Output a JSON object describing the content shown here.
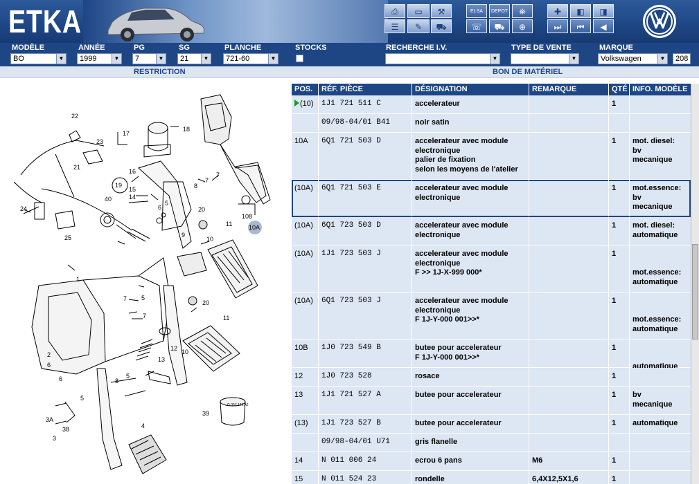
{
  "app": {
    "logo": "ETKA"
  },
  "toolbar": {
    "buttons": [
      {
        "name": "print-icon",
        "glyph": "⎙"
      },
      {
        "name": "monitor-icon",
        "glyph": "▭"
      },
      {
        "name": "tools-icon",
        "glyph": "⚒"
      },
      {
        "name": "list-icon",
        "glyph": "☰"
      },
      {
        "name": "pencil-icon",
        "glyph": "✎"
      },
      {
        "name": "cart-icon",
        "glyph": "⛟"
      },
      {
        "name": "elsa-icon",
        "label": "ELSA"
      },
      {
        "name": "depot-icon",
        "label": "DEPOT"
      },
      {
        "name": "basket-icon",
        "glyph": "🛒"
      },
      {
        "name": "pin-icon",
        "glyph": "✚"
      },
      {
        "name": "doc-prev-icon",
        "glyph": "◧"
      },
      {
        "name": "doc-next-icon",
        "glyph": "◨"
      },
      {
        "name": "last-icon",
        "glyph": "⏭"
      },
      {
        "name": "first-icon",
        "glyph": "⏮"
      },
      {
        "name": "back-icon",
        "glyph": "◀"
      }
    ]
  },
  "filters": {
    "modele": {
      "label": "MODÈLE",
      "value": "BO"
    },
    "annee": {
      "label": "ANNÉE",
      "value": "1999"
    },
    "pg": {
      "label": "PG",
      "value": "7"
    },
    "sg": {
      "label": "SG",
      "value": "21"
    },
    "planche": {
      "label": "PLANCHE",
      "value": "721-60"
    },
    "stocks": {
      "label": "STOCKS"
    },
    "recherche": {
      "label": "RECHERCHE I.V.",
      "value": ""
    },
    "type_vente": {
      "label": "TYPE DE VENTE",
      "value": ""
    },
    "marque": {
      "label": "MARQUE",
      "value": "Volkswagen",
      "code": "208"
    }
  },
  "subheader": {
    "restriction": "RESTRICTION",
    "bon": "BON DE MATÉRIEL"
  },
  "table": {
    "headers": [
      "POS.",
      "RÉF. PIÈCE",
      "DÉSIGNATION",
      "REMARQUE",
      "QTÉ",
      "INFO. MODÈLE"
    ],
    "rows": [
      {
        "pos": "(10)",
        "ref": "1J1  721  511  C",
        "des": [
          "accelerateur"
        ],
        "rem": "",
        "qty": "1",
        "info": [],
        "h": 27,
        "arrow": true
      },
      {
        "pos": "",
        "ref": "09/98-04/01 B41",
        "des": [
          "noir satin"
        ],
        "rem": "",
        "qty": "",
        "info": [],
        "h": 27
      },
      {
        "pos": "10A",
        "ref": "6Q1  721  503  D",
        "des": [
          "accelerateur avec module",
          "electronique",
          "palier de fixation",
          "selon les moyens de l'atelier"
        ],
        "rem": "",
        "qty": "1",
        "info": [
          "mot. diesel:",
          "bv",
          "mecanique"
        ],
        "h": 68
      },
      {
        "pos": "(10A)",
        "ref": "6Q1  721  503  E",
        "des": [
          "accelerateur avec module",
          "electronique"
        ],
        "rem": "",
        "qty": "1",
        "info": [
          "mot.essence:",
          "bv",
          "mecanique"
        ],
        "h": 54,
        "selected": true
      },
      {
        "pos": "(10A)",
        "ref": "6Q1  723  503  D",
        "des": [
          "accelerateur avec module",
          "electronique"
        ],
        "rem": "",
        "qty": "1",
        "info": [
          "mot. diesel:",
          "automatique"
        ],
        "h": 41
      },
      {
        "pos": "(10A)",
        "ref": "1J1  723  503  J",
        "des": [
          "accelerateur avec module",
          "electronique",
          "F            >> 1J-X-999 000*"
        ],
        "rem": "",
        "qty": "1",
        "info": [
          "",
          "",
          "mot.essence:",
          "automatique"
        ],
        "h": 68
      },
      {
        "pos": "(10A)",
        "ref": "6Q1  723  503  J",
        "des": [
          "accelerateur avec module",
          "electronique",
          "F 1J-Y-000 001>>*"
        ],
        "rem": "",
        "qty": "1",
        "info": [
          "",
          "",
          "mot.essence:",
          "automatique"
        ],
        "h": 68
      },
      {
        "pos": "10B",
        "ref": "1J0  723  549  B",
        "des": [
          "butee pour accelerateur",
          "F 1J-Y-000 001>>*"
        ],
        "rem": "",
        "qty": "1",
        "info": [
          "",
          "",
          "automatique"
        ],
        "h": 41
      },
      {
        "pos": "12",
        "ref": "1J0  723  528",
        "des": [
          "rosace"
        ],
        "rem": "",
        "qty": "1",
        "info": [],
        "h": 27
      },
      {
        "pos": "13",
        "ref": "1J1  721  527  A",
        "des": [
          "butee pour accelerateur"
        ],
        "rem": "",
        "qty": "1",
        "info": [
          "bv",
          "mecanique"
        ],
        "h": 41
      },
      {
        "pos": "(13)",
        "ref": "1J1  723  527  B",
        "des": [
          "butee pour accelerateur"
        ],
        "rem": "",
        "qty": "1",
        "info": [
          "automatique"
        ],
        "h": 27
      },
      {
        "pos": "",
        "ref": "09/98-04/01 U71",
        "des": [
          "gris flanelle"
        ],
        "rem": "",
        "qty": "",
        "info": [],
        "h": 27
      },
      {
        "pos": "14",
        "ref": "N    011  006  24",
        "des": [
          "ecrou 6 pans"
        ],
        "rem": "M6",
        "qty": "1",
        "info": [],
        "h": 27
      },
      {
        "pos": "15",
        "ref": "N    011  524  23",
        "des": [
          "rondelle"
        ],
        "rem": "6,4X12,5X1,6",
        "qty": "1",
        "info": [],
        "h": 27
      }
    ]
  },
  "diagram": {
    "callouts": [
      "22",
      "23",
      "17",
      "18",
      "21",
      "16",
      "7",
      "19",
      "15",
      "14",
      "8",
      "24",
      "40",
      "5",
      "6",
      "20",
      "11",
      "10",
      "108",
      "10A",
      "25",
      "9",
      "1",
      "12",
      "13",
      "3",
      "3A",
      "38",
      "39",
      "4",
      "2"
    ],
    "stamp": "G 057 142 A2"
  }
}
